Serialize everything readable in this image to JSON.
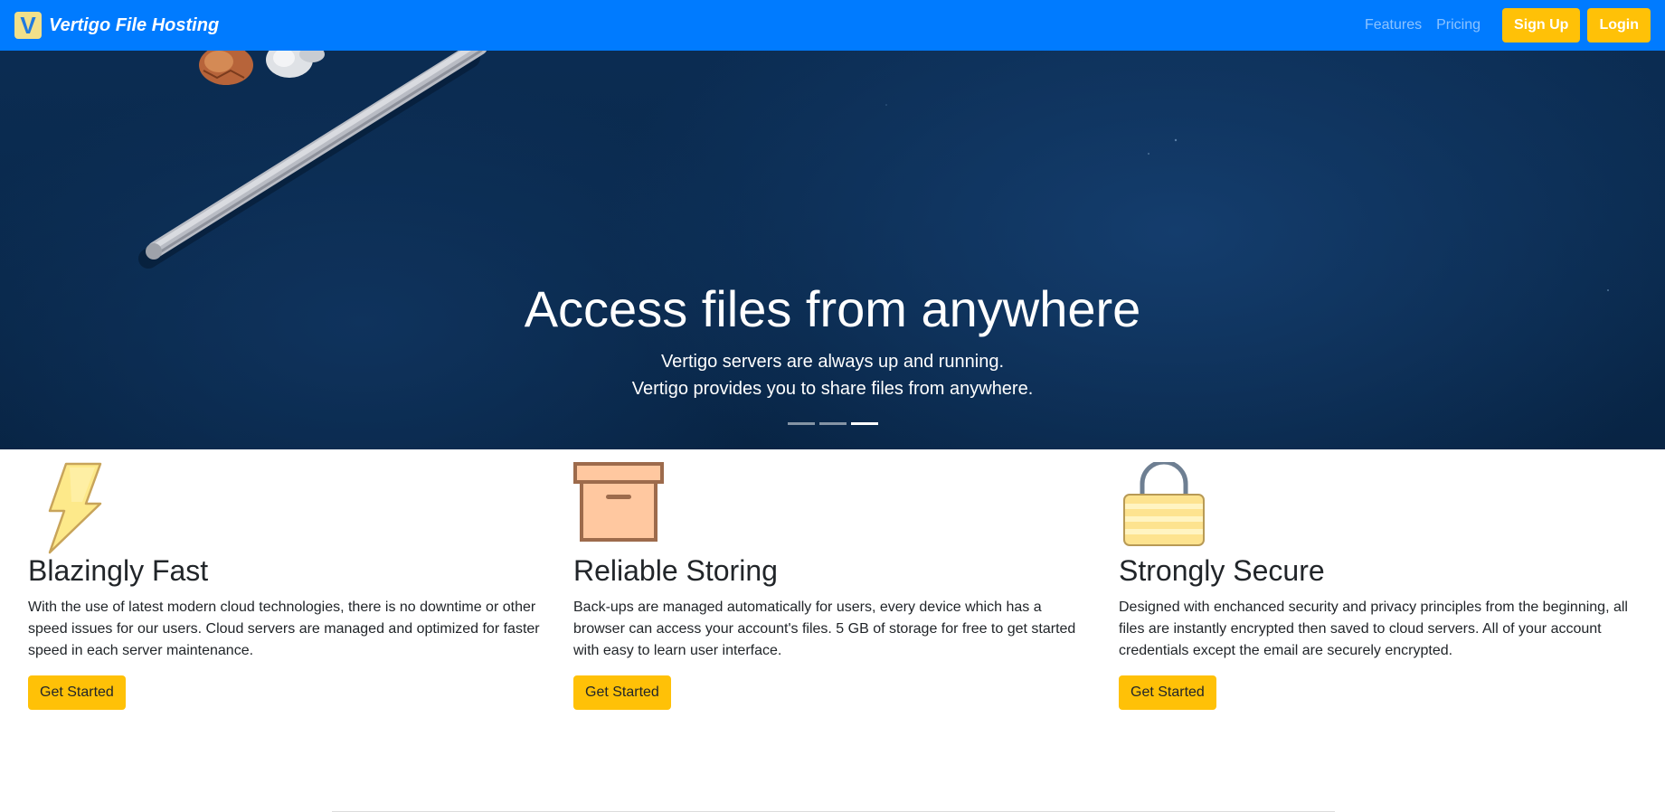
{
  "navbar": {
    "logo_letter": "V",
    "brand": "Vertigo File Hosting",
    "links": [
      "Features",
      "Pricing"
    ],
    "signup": "Sign Up",
    "login": "Login",
    "background": "#007bff",
    "button_color": "#ffc107"
  },
  "hero": {
    "title": "Access files from anywhere",
    "line1": "Vertigo servers are always up and running.",
    "line2": "Vertigo provides you to share files from anywhere.",
    "slides": 3,
    "active_slide": 3
  },
  "features": [
    {
      "icon": "lightning-icon",
      "title": "Blazingly Fast",
      "text": "With the use of latest modern cloud technologies, there is no downtime or other speed issues for our users. Cloud servers are managed and optimized for faster speed in each server maintenance.",
      "button": "Get Started"
    },
    {
      "icon": "box-icon",
      "title": "Reliable Storing",
      "text": "Back-ups are managed automatically for users, every device which has a browser can access your account's files. 5 GB of storage for free to get started with easy to learn user interface.",
      "button": "Get Started"
    },
    {
      "icon": "lock-icon",
      "title": "Strongly Secure",
      "text": "Designed with enchanced security and privacy principles from the beginning, all files are instantly encrypted then saved to cloud servers. All of your account credentials except the email are securely encrypted.",
      "button": "Get Started"
    }
  ]
}
